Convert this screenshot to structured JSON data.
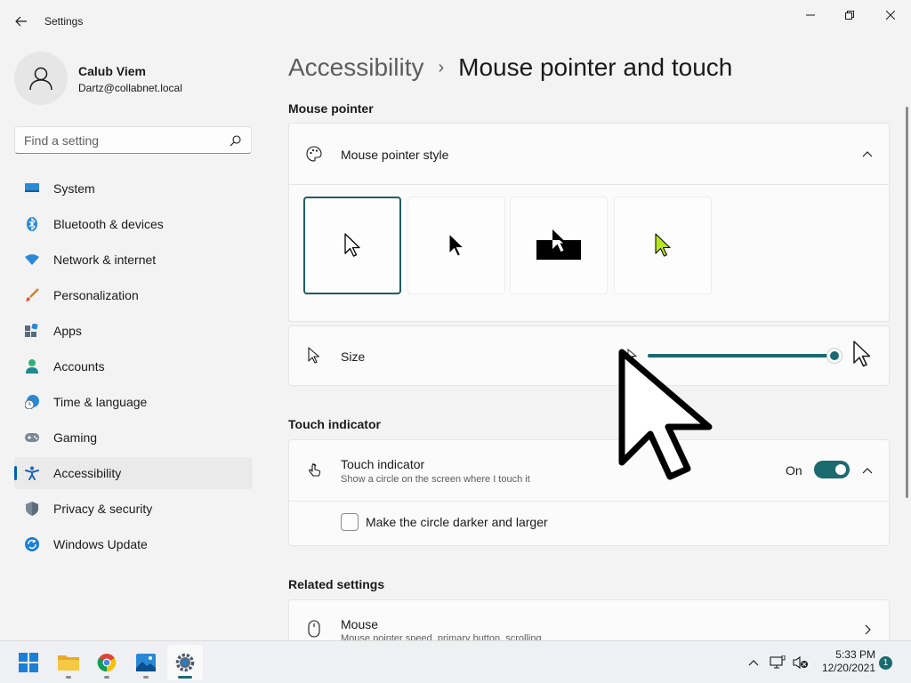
{
  "window": {
    "title": "Settings"
  },
  "profile": {
    "name": "Calub Viem",
    "email": "Dartz@collabnet.local"
  },
  "search": {
    "placeholder": "Find a setting",
    "value": ""
  },
  "sidebar": {
    "items": [
      {
        "label": "System",
        "icon": "system-icon"
      },
      {
        "label": "Bluetooth & devices",
        "icon": "bluetooth-icon"
      },
      {
        "label": "Network & internet",
        "icon": "network-icon"
      },
      {
        "label": "Personalization",
        "icon": "brush-icon"
      },
      {
        "label": "Apps",
        "icon": "apps-icon"
      },
      {
        "label": "Accounts",
        "icon": "accounts-icon"
      },
      {
        "label": "Time & language",
        "icon": "clock-globe-icon"
      },
      {
        "label": "Gaming",
        "icon": "gamepad-icon"
      },
      {
        "label": "Accessibility",
        "icon": "accessibility-icon",
        "active": true
      },
      {
        "label": "Privacy & security",
        "icon": "shield-icon"
      },
      {
        "label": "Windows Update",
        "icon": "update-icon"
      }
    ]
  },
  "header": {
    "parent": "Accessibility",
    "separator": "›",
    "current": "Mouse pointer and touch"
  },
  "mouse_pointer": {
    "section_title": "Mouse pointer",
    "style_label": "Mouse pointer style",
    "styles": [
      {
        "name": "white",
        "selected": true
      },
      {
        "name": "black",
        "selected": false
      },
      {
        "name": "inverted",
        "selected": false
      },
      {
        "name": "custom",
        "selected": false
      }
    ],
    "size_label": "Size",
    "size_value": 1.0
  },
  "touch": {
    "section_title": "Touch indicator",
    "label": "Touch indicator",
    "description": "Show a circle on the screen where I touch it",
    "toggle_state": "On",
    "checkbox_label": "Make the circle darker and larger",
    "checkbox_checked": false
  },
  "related": {
    "section_title": "Related settings",
    "mouse_label": "Mouse",
    "mouse_description": "Mouse pointer speed, primary button, scrolling"
  },
  "taskbar": {
    "apps": [
      "start-icon",
      "file-explorer-icon",
      "chrome-icon",
      "photos-icon",
      "settings-icon"
    ],
    "time": "5:33 PM",
    "date": "12/20/2021",
    "notifications": "1"
  },
  "colors": {
    "accent": "#1a6a70",
    "nav_indicator": "#005fb8",
    "custom_cursor": "#b7e51f"
  }
}
